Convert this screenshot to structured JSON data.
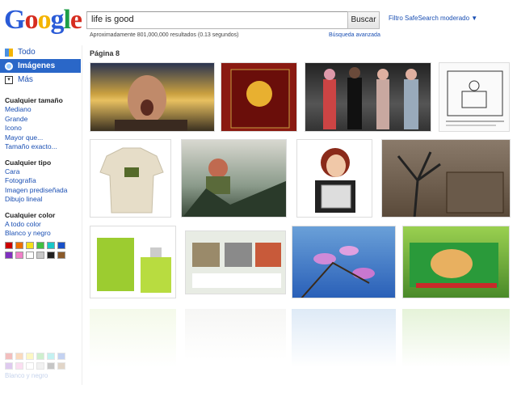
{
  "logo": [
    "G",
    "o",
    "o",
    "g",
    "l",
    "e"
  ],
  "search": {
    "query": "life is good",
    "button": "Buscar",
    "safesearch": "Filtro SafeSearch moderado ▼"
  },
  "stats": "Aproximadamente 801,000,000 resultados (0.13 segundos)",
  "advanced_search": "Búsqueda avanzada",
  "page_label": "Página 8",
  "nav": [
    {
      "label": "Todo",
      "icon": "web-icon"
    },
    {
      "label": "Imágenes",
      "icon": "images-icon"
    },
    {
      "label": "Más",
      "icon": "more-icon"
    }
  ],
  "filters": {
    "size": {
      "title": "Cualquier tamaño",
      "items": [
        "Mediano",
        "Grande",
        "Icono",
        "Mayor que...",
        "Tamaño exacto..."
      ]
    },
    "type": {
      "title": "Cualquier tipo",
      "items": [
        "Cara",
        "Fotografía",
        "Imagen prediseñada",
        "Dibujo lineal"
      ]
    },
    "color": {
      "title": "Cualquier color",
      "items": [
        "A todo color",
        "Blanco y negro"
      ]
    },
    "swatches": [
      "#cc0000",
      "#ee6f00",
      "#f5e01a",
      "#40c040",
      "#18c8c8",
      "#1850c8",
      "#8030c0",
      "#f080c8",
      "#ffffff",
      "#c8c8c8",
      "#202020",
      "#8a5a2a"
    ]
  },
  "faded_text": "Blanco y negro"
}
